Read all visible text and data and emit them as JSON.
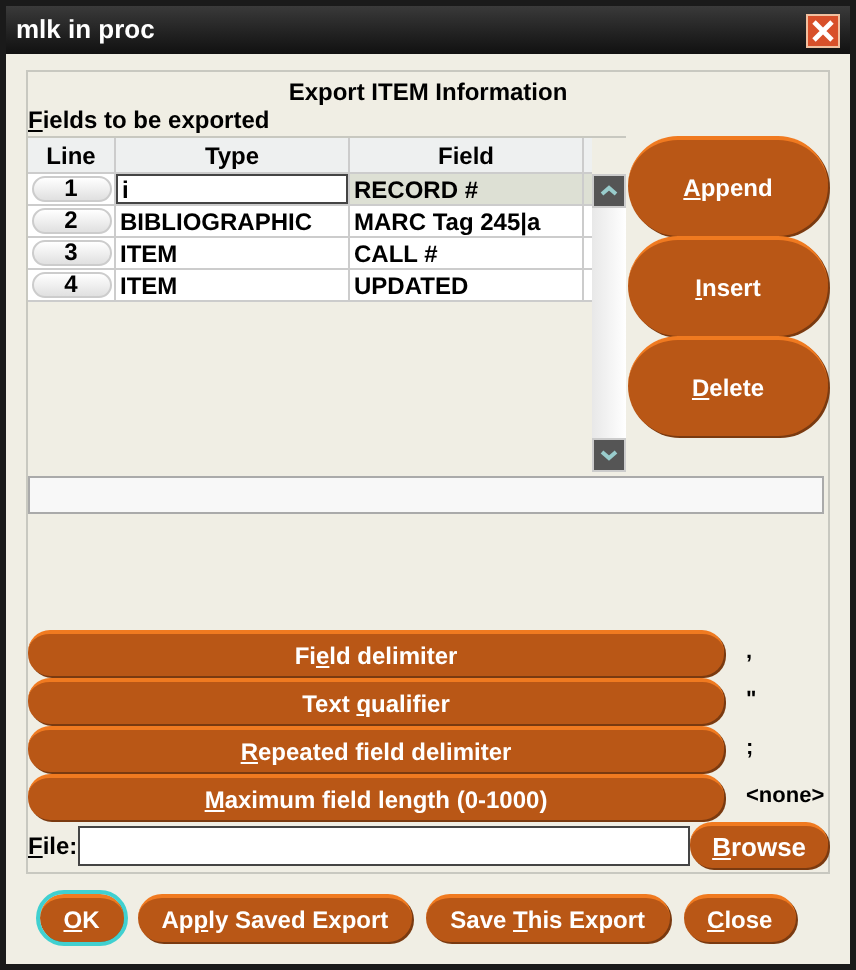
{
  "window": {
    "title": "mlk in proc"
  },
  "heading": "Export ITEM Information",
  "fields_label": {
    "key": "F",
    "post": "ields to be exported"
  },
  "table": {
    "columns": [
      "Line",
      "Type",
      "Field"
    ],
    "rows": [
      {
        "line": "1",
        "type": "i",
        "field": "RECORD #",
        "selected": true,
        "editing": true
      },
      {
        "line": "2",
        "type": "BIBLIOGRAPHIC",
        "field": "MARC Tag 245|a",
        "selected": false,
        "editing": false
      },
      {
        "line": "3",
        "type": "ITEM",
        "field": "CALL #",
        "selected": false,
        "editing": false
      },
      {
        "line": "4",
        "type": "ITEM",
        "field": "UPDATED",
        "selected": false,
        "editing": false
      }
    ]
  },
  "side_buttons": [
    {
      "key": "A",
      "post": "ppend"
    },
    {
      "key": "I",
      "post": "nsert"
    },
    {
      "key": "D",
      "post": "elete"
    }
  ],
  "options": [
    {
      "pre": "Fi",
      "key": "e",
      "post": "ld delimiter",
      "value": ","
    },
    {
      "pre": "Text ",
      "key": "q",
      "post": "ualifier",
      "value": "\""
    },
    {
      "key": "R",
      "post": "epeated field delimiter",
      "value": ";"
    },
    {
      "key": "M",
      "post": "aximum field length (0-1000)",
      "value": "<none>"
    }
  ],
  "file": {
    "label": {
      "key": "F",
      "post": "ile:"
    },
    "browse": {
      "key": "B",
      "post": "rowse"
    }
  },
  "footer_buttons": [
    {
      "key": "O",
      "post": "K",
      "focused": true
    },
    {
      "pre": "Ap",
      "key": "p",
      "post": "ly Saved Export",
      "focused": false
    },
    {
      "pre": "Save ",
      "key": "T",
      "post": "his Export",
      "focused": false
    },
    {
      "key": "C",
      "post": "lose",
      "focused": false
    }
  ]
}
